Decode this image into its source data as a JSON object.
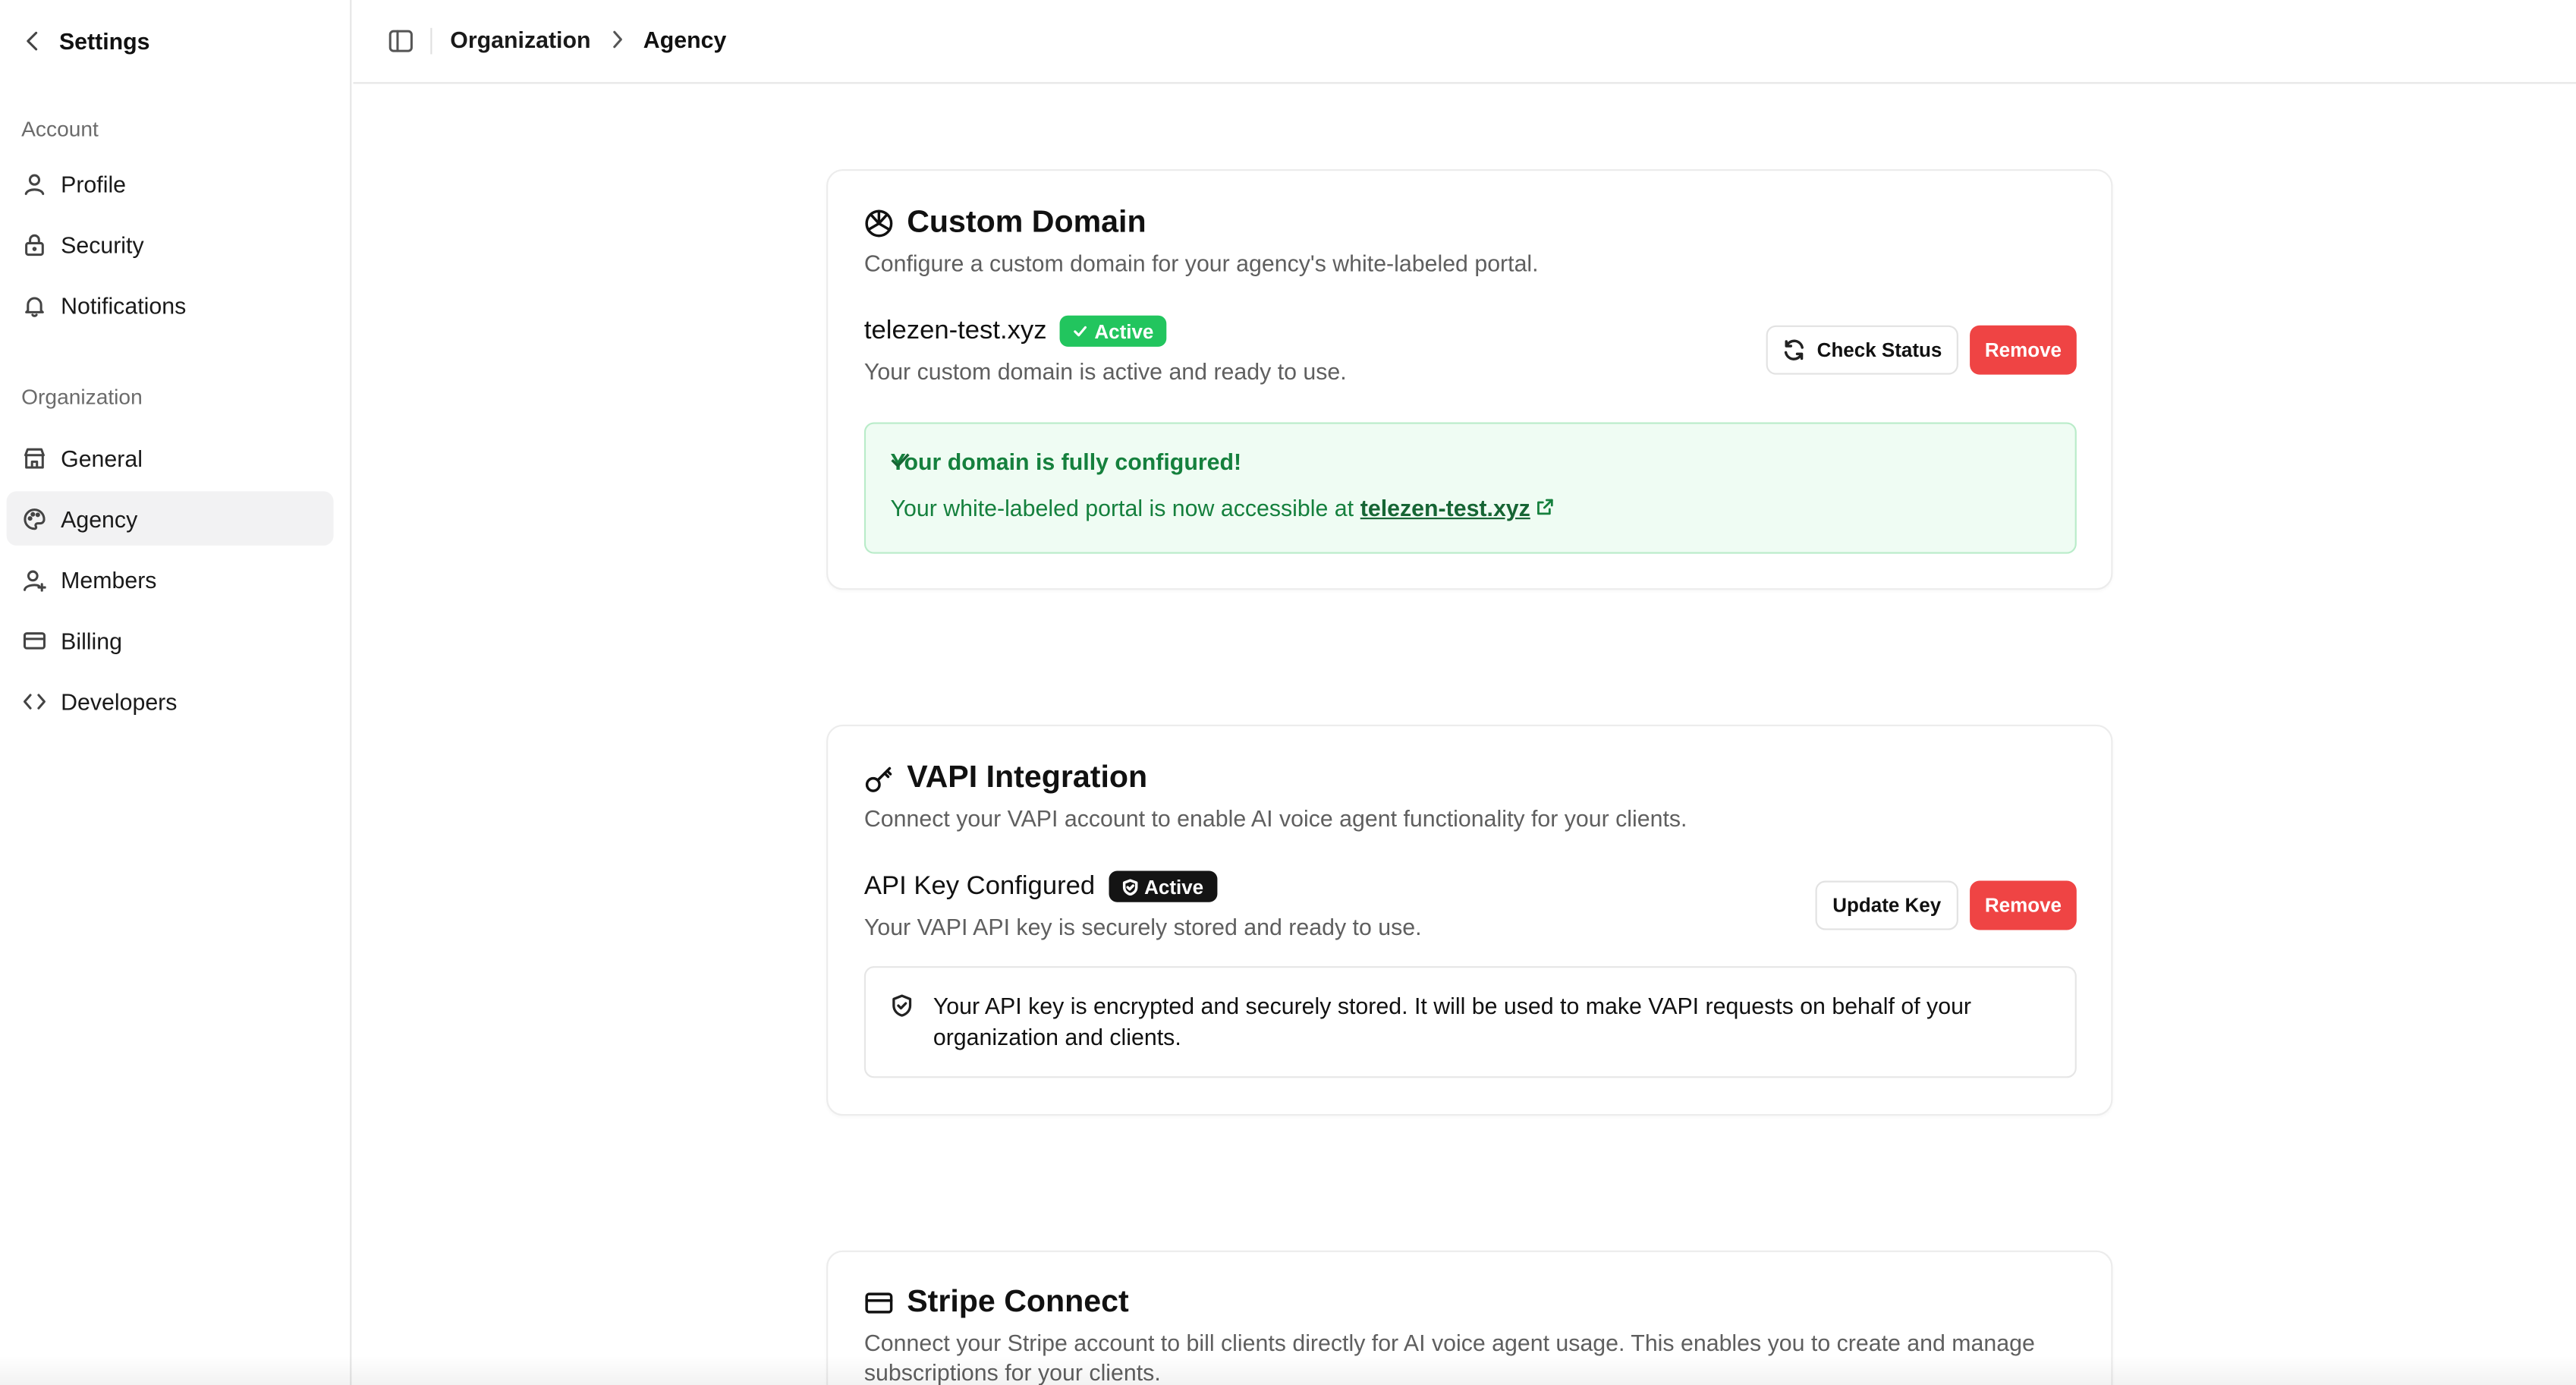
{
  "sidebar": {
    "header": {
      "back_icon": "chevron-left-icon",
      "title": "Settings"
    },
    "groups": [
      {
        "label": "Account"
      },
      {
        "label": "Organization"
      }
    ],
    "items": [
      {
        "label": "Profile",
        "icon": "user-icon"
      },
      {
        "label": "Security",
        "icon": "lock-icon"
      },
      {
        "label": "Notifications",
        "icon": "bell-icon"
      },
      {
        "label": "General",
        "icon": "store-icon"
      },
      {
        "label": "Agency",
        "icon": "palette-icon",
        "active": true
      },
      {
        "label": "Members",
        "icon": "user-plus-icon"
      },
      {
        "label": "Billing",
        "icon": "credit-card-icon"
      },
      {
        "label": "Developers",
        "icon": "code-icon"
      }
    ]
  },
  "topbar": {
    "toggle_icon": "sidebar-toggle-icon",
    "breadcrumb": [
      "Organization",
      "Agency"
    ]
  },
  "custom_domain": {
    "title": "Custom Domain",
    "icon": "globe-icon",
    "description": "Configure a custom domain for your agency's white-labeled portal.",
    "domain": "telezen-test.xyz",
    "badge": "Active",
    "status_text": "Your custom domain is active and ready to use.",
    "check_status_label": "Check Status",
    "remove_label": "Remove",
    "success_title": "Your domain is fully configured!",
    "success_text": "Your white-labeled portal is now accessible at",
    "success_link": "telezen-test.xyz"
  },
  "vapi": {
    "title": "VAPI Integration",
    "icon": "key-icon",
    "description": "Connect your VAPI account to enable AI voice agent functionality for your clients.",
    "row_title": "API Key Configured",
    "badge": "Active",
    "status_text": "Your VAPI API key is securely stored and ready to use.",
    "update_label": "Update Key",
    "remove_label": "Remove",
    "info_text": "Your API key is encrypted and securely stored. It will be used to make VAPI requests on behalf of your organization and clients."
  },
  "stripe": {
    "title": "Stripe Connect",
    "icon": "credit-card-icon",
    "description": "Connect your Stripe account to bill clients directly for AI voice agent usage. This enables you to create and manage subscriptions for your clients."
  },
  "colors": {
    "active_green": "#22c55e",
    "remove_red": "#ef4444",
    "success_bg": "#effcf3",
    "success_text": "#15803d"
  }
}
